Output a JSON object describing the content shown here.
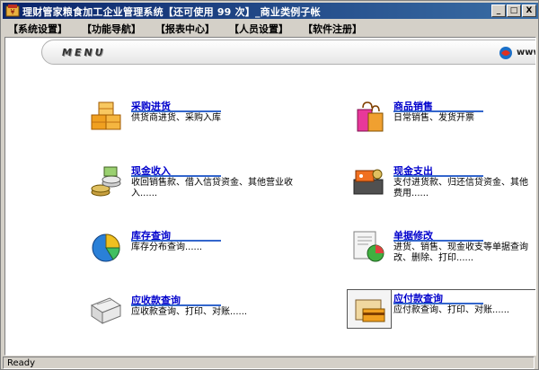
{
  "window": {
    "title": "理财管家粮食加工企业管理系统【还可使用 99 次】_商业类例子帐",
    "min_label": "_",
    "max_label": "□",
    "close_label": "X"
  },
  "menubar": {
    "items": [
      {
        "label": "【系统设置】"
      },
      {
        "label": "【功能导航】"
      },
      {
        "label": "【报表中心】"
      },
      {
        "label": "【人员设置】"
      },
      {
        "label": "【软件注册】"
      }
    ]
  },
  "banner": {
    "menu_text": "MENU",
    "www_text": "www."
  },
  "functions": [
    {
      "id": "purchase",
      "title": "采购进货",
      "desc": "供货商进货、采购入库",
      "icon": "boxes-icon"
    },
    {
      "id": "sales",
      "title": "商品销售",
      "desc": "日常销售、发货开票",
      "icon": "shopping-bags-icon"
    },
    {
      "id": "cash-in",
      "title": "现金收入",
      "desc": "收回销售款、借入信贷资金、其他营业收入......",
      "icon": "coins-icon"
    },
    {
      "id": "cash-out",
      "title": "现金支出",
      "desc": "支付进货款、归还信贷资金、其他费用......",
      "icon": "wallet-cash-icon"
    },
    {
      "id": "stock",
      "title": "库存查询",
      "desc": "库存分布查询......",
      "icon": "pie-chart-icon"
    },
    {
      "id": "doc-edit",
      "title": "单据修改",
      "desc": "进货、销售、现金收支等单据查询改、删除、打印......",
      "icon": "document-chart-icon"
    },
    {
      "id": "receivable",
      "title": "应收款查询",
      "desc": "应收款查询、打印、对账......",
      "icon": "notebook-icon"
    },
    {
      "id": "payable",
      "title": "应付款查询",
      "desc": "应付款查询、打印、对账......",
      "icon": "card-folder-icon"
    }
  ],
  "statusbar": {
    "text": "Ready"
  },
  "colors": {
    "titlebar_start": "#0a246a",
    "titlebar_end": "#3a6ea5",
    "link_blue": "#0000cc",
    "underline_blue": "#3366cc"
  }
}
